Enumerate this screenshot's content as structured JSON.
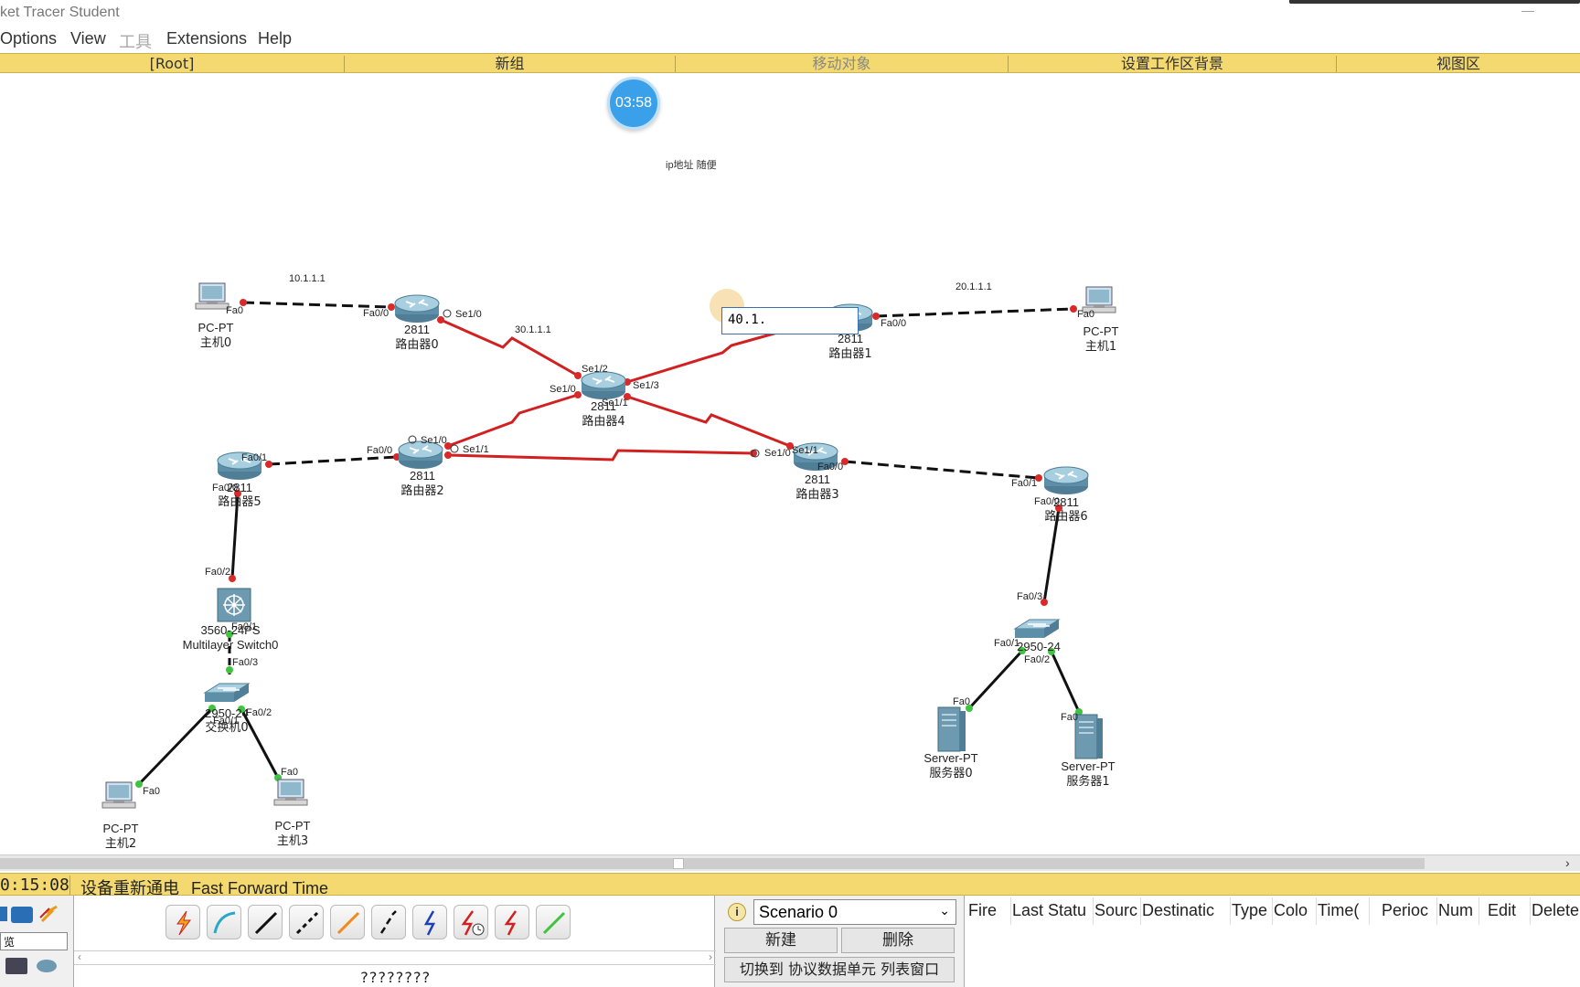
{
  "app": {
    "title": "ket Tracer Student"
  },
  "menu": {
    "items": [
      "Options",
      "View",
      "工具",
      "Extensions",
      "Help"
    ]
  },
  "workspace_bar": {
    "items": [
      "[Root]",
      "新组",
      "移动对象",
      "设置工作区背景",
      "视图区"
    ]
  },
  "timer": "03:58",
  "note": "ip地址 随便",
  "ip_input_value": "40.1.",
  "devices": [
    {
      "id": "pc0",
      "type": "PC-PT",
      "name": "主机0"
    },
    {
      "id": "pc1",
      "type": "PC-PT",
      "name": "主机1"
    },
    {
      "id": "r0",
      "type": "2811",
      "name": "路由器0"
    },
    {
      "id": "r1",
      "type": "2811",
      "name": "路由器1"
    },
    {
      "id": "r4",
      "type": "2811",
      "name": "路由器4"
    },
    {
      "id": "r2",
      "type": "2811",
      "name": "路由器2"
    },
    {
      "id": "r3",
      "type": "2811",
      "name": "路由器3"
    },
    {
      "id": "r5",
      "type": "2811",
      "name": "路由器5"
    },
    {
      "id": "r6",
      "type": "2811",
      "name": "路由器6"
    },
    {
      "id": "mls0",
      "type": "3560-24PS",
      "name": "Multilayer Switch0"
    },
    {
      "id": "sw0",
      "type": "2950-24",
      "name": "交换机0"
    },
    {
      "id": "sw1",
      "type": "2950-24",
      "name": ""
    },
    {
      "id": "pc2",
      "type": "PC-PT",
      "name": "主机2"
    },
    {
      "id": "pc3",
      "type": "PC-PT",
      "name": "主机3"
    },
    {
      "id": "srv0",
      "type": "Server-PT",
      "name": "服务器0"
    },
    {
      "id": "srv1",
      "type": "Server-PT",
      "name": "服务器1"
    }
  ],
  "network_labels": [
    "10.1.1.1",
    "20.1.1.1",
    "30.1.1.1"
  ],
  "port_labels": {
    "pc0_fa0": "Fa0",
    "r0_fa00": "Fa0/0",
    "r0_se10": "Se1/0",
    "r1_fa00": "Fa0/0",
    "pc1_fa0": "Fa0",
    "r4_se12": "Se1/2",
    "r4_se10": "Se1/0",
    "r4_se13": "Se1/3",
    "r4_se11": "Se1/1",
    "r2_se10": "Se1/0",
    "r2_se11": "Se1/1",
    "r2_fa00": "Fa0/0",
    "r3_se10": "Se1/0",
    "r3_se11": "Se1/1",
    "r3_fa00": "Fa0/0",
    "r5_fa01": "Fa0/1",
    "r5_fa00": "Fa0/0",
    "r6_fa01": "Fa0/1",
    "r6_fa00": "Fa0/0",
    "mls_fa02": "Fa0/2",
    "mls_fa01": "Fa0/1",
    "mls_fa03": "Fa0/3",
    "sw0_fa01": "Fa0/1",
    "sw0_fa02": "Fa0/2",
    "pc2_fa0": "Fa0",
    "pc3_fa0": "Fa0",
    "sw1_fa03": "Fa0/3",
    "sw1_fa01": "Fa0/1",
    "sw1_fa02": "Fa0/2",
    "srv0_fa0": "Fa0",
    "srv1_fa0": "Fa0"
  },
  "status": {
    "time": "0:15:08",
    "power_cycle": "设备重新通电",
    "fast_forward": "Fast Forward Time"
  },
  "bottom": {
    "device_search": "览",
    "footer": "????????",
    "scenario": {
      "selected": "Scenario 0",
      "new_label": "新建",
      "delete_label": "删除",
      "toggle_label": "切换到 协议数据单元 列表窗口"
    },
    "pdu_columns": [
      "Fire",
      "Last Statu",
      "Sourc",
      "Destinatic",
      "Type",
      "Colo",
      "Time(",
      "Perioc",
      "Num",
      "Edit",
      "Delete"
    ]
  },
  "colors": {
    "workspace_bar": "#f3d96f",
    "serial_link": "#d22020",
    "ethernet_link": "#111111",
    "port_down": "#d92a2a",
    "port_up": "#3ec43e",
    "timer": "#3aa0ea"
  },
  "icons": {
    "info": "info-icon",
    "connection_tools": [
      "auto-connect-icon",
      "console-cable-icon",
      "straight-through-icon",
      "crossover-icon",
      "fiber-icon",
      "phone-icon",
      "coaxial-icon",
      "serial-dce-icon",
      "serial-dte-icon",
      "octal-icon"
    ]
  }
}
